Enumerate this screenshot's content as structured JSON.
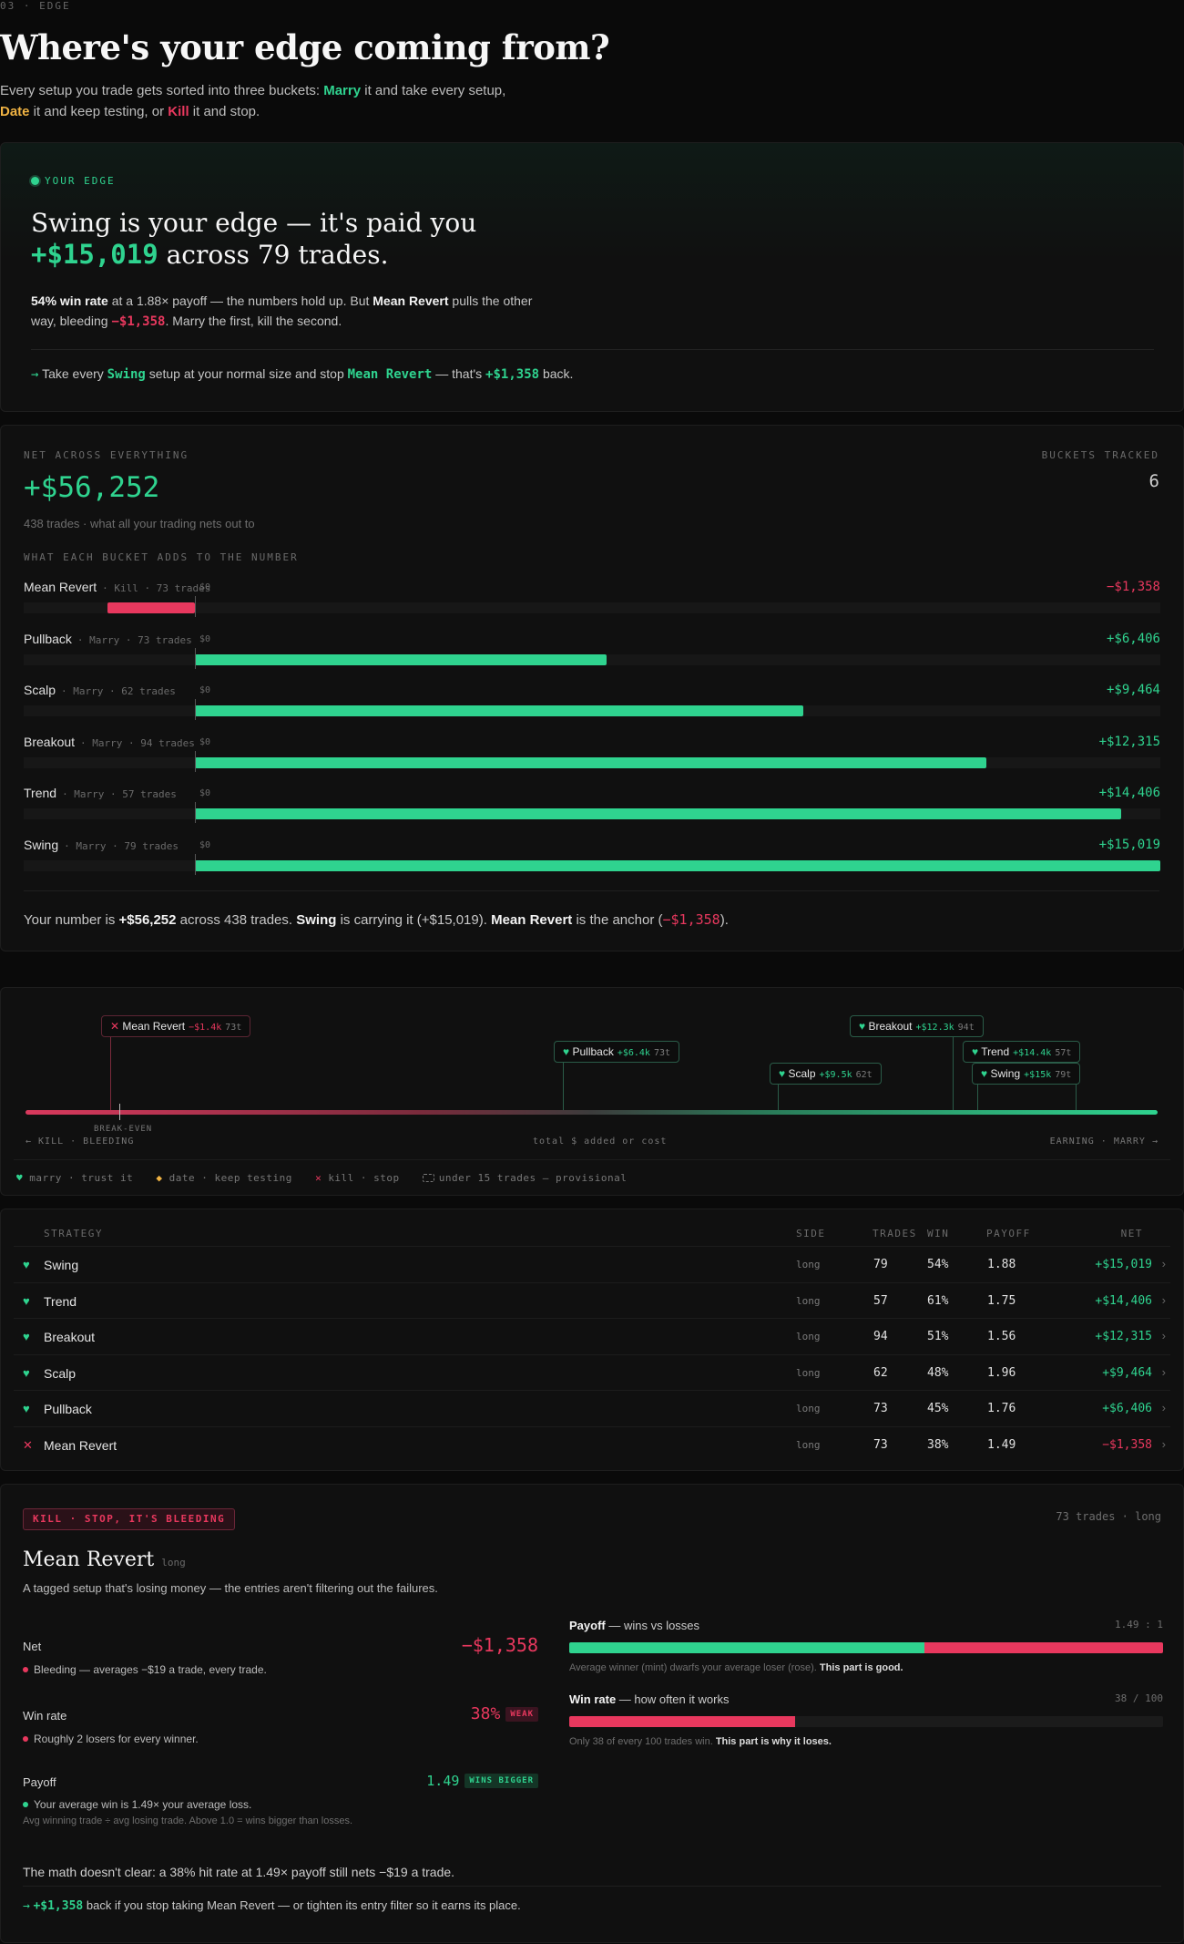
{
  "header": {
    "eyebrow": "03 · EDGE",
    "title": "Where's your edge coming from?",
    "intro_a": "Every setup you trade gets sorted into three buckets: ",
    "marry": "Marry",
    "intro_b": " it and take every setup, ",
    "date": "Date",
    "intro_c": " it and keep testing, or ",
    "kill": "Kill",
    "intro_d": " it and stop."
  },
  "edge": {
    "tag": "YOUR EDGE",
    "headline_a": "Swing is your edge — it's paid you",
    "amount": "+$15,019",
    "headline_b": " across 79 trades.",
    "p1_bold": "54% win rate",
    "p1_a": " at a 1.88× payoff — the numbers hold up. But ",
    "p1_bold2": "Mean Revert",
    "p1_b": " pulls the other way, bleeding ",
    "p1_loss": "−$1,358",
    "p1_c": ". Marry the first, kill the second.",
    "act_arrow": "→",
    "act_a": " Take every ",
    "act_swing": "Swing",
    "act_b": " setup at your normal size and stop ",
    "act_mr": "Mean Revert",
    "act_c": " — that's ",
    "act_val": "+$1,358",
    "act_d": " back."
  },
  "net": {
    "label": "NET ACROSS EVERYTHING",
    "buckets_label": "BUCKETS TRACKED",
    "total": "+$56,252",
    "buckets": "6",
    "sub": "438 trades · what all your trading nets out to",
    "adds_label": "WHAT EACH BUCKET ADDS TO THE NUMBER",
    "zero_label": "$0",
    "summary_a": "Your number is ",
    "summary_total": "+$56,252",
    "summary_b": " across 438 trades. ",
    "summary_swing": "Swing",
    "summary_c": " is carrying it (+$15,019). ",
    "summary_mr": "Mean Revert",
    "summary_d": " is the anchor (",
    "summary_loss": "−$1,358",
    "summary_e": ").",
    "rows": [
      {
        "name": "Mean Revert",
        "meta": "· Kill · 73 trades",
        "value": "−$1,358",
        "amount": -1358
      },
      {
        "name": "Pullback",
        "meta": "· Marry · 73 trades",
        "value": "+$6,406",
        "amount": 6406
      },
      {
        "name": "Scalp",
        "meta": "· Marry · 62 trades",
        "value": "+$9,464",
        "amount": 9464
      },
      {
        "name": "Breakout",
        "meta": "· Marry · 94 trades",
        "value": "+$12,315",
        "amount": 12315
      },
      {
        "name": "Trend",
        "meta": "· Marry · 57 trades",
        "value": "+$14,406",
        "amount": 14406
      },
      {
        "name": "Swing",
        "meta": "· Marry · 79 trades",
        "value": "+$15,019",
        "amount": 15019
      }
    ]
  },
  "spectrum": {
    "flags": [
      {
        "name": "Mean Revert",
        "val": "−$1.4k",
        "n": "73t",
        "kind": "kill"
      },
      {
        "name": "Pullback",
        "val": "+$6.4k",
        "n": "73t",
        "kind": "marry"
      },
      {
        "name": "Scalp",
        "val": "+$9.5k",
        "n": "62t",
        "kind": "marry"
      },
      {
        "name": "Breakout",
        "val": "+$12.3k",
        "n": "94t",
        "kind": "marry"
      },
      {
        "name": "Trend",
        "val": "+$14.4k",
        "n": "57t",
        "kind": "marry"
      },
      {
        "name": "Swing",
        "val": "+$15k",
        "n": "79t",
        "kind": "marry"
      }
    ],
    "breakeven": "BREAK-EVEN",
    "axis_left": "← KILL · BLEEDING",
    "axis_mid": "total $ added or cost",
    "axis_right": "EARNING · MARRY →",
    "legend_marry": "marry · trust it",
    "legend_date": "date · keep testing",
    "legend_kill": "kill · stop",
    "legend_prov": "under 15 trades — provisional"
  },
  "table": {
    "headers": {
      "strategy": "STRATEGY",
      "side": "SIDE",
      "trades": "TRADES",
      "win": "WIN",
      "payoff": "PAYOFF",
      "net": "NET"
    },
    "rows": [
      {
        "icon": "♥",
        "name": "Swing",
        "side": "long",
        "trades": "79",
        "win": "54%",
        "payoff": "1.88",
        "net": "+$15,019",
        "kind": "marry"
      },
      {
        "icon": "♥",
        "name": "Trend",
        "side": "long",
        "trades": "57",
        "win": "61%",
        "payoff": "1.75",
        "net": "+$14,406",
        "kind": "marry"
      },
      {
        "icon": "♥",
        "name": "Breakout",
        "side": "long",
        "trades": "94",
        "win": "51%",
        "payoff": "1.56",
        "net": "+$12,315",
        "kind": "marry"
      },
      {
        "icon": "♥",
        "name": "Scalp",
        "side": "long",
        "trades": "62",
        "win": "48%",
        "payoff": "1.96",
        "net": "+$9,464",
        "kind": "marry"
      },
      {
        "icon": "♥",
        "name": "Pullback",
        "side": "long",
        "trades": "73",
        "win": "45%",
        "payoff": "1.76",
        "net": "+$6,406",
        "kind": "marry"
      },
      {
        "icon": "✕",
        "name": "Mean Revert",
        "side": "long",
        "trades": "73",
        "win": "38%",
        "payoff": "1.49",
        "net": "−$1,358",
        "kind": "kill"
      }
    ],
    "row_more": "›"
  },
  "detail": {
    "badge": "KILL · STOP, IT'S BLEEDING",
    "top_right": "73 trades · long",
    "title": "Mean Revert",
    "side": "long",
    "desc": "A tagged setup that's losing money — the entries aren't filtering out the failures.",
    "net_k": "Net",
    "net_v": "−$1,358",
    "net_note": "Bleeding — averages −$19 a trade, every trade.",
    "win_k": "Win rate",
    "win_v": "38%",
    "win_chip": "WEAK",
    "win_note": "Roughly 2 losers for every winner.",
    "pay_k": "Payoff",
    "pay_v": "1.49",
    "pay_chip": "WINS BIGGER",
    "pay_note": "Your average win is 1.49× your average loss.",
    "pay_note2": "Avg winning trade ÷ avg losing trade. Above 1.0 = wins bigger than losses.",
    "r1_k": "Payoff",
    "r1_k2": " — wins vs losses",
    "r1_r": "1.49 : 1",
    "r1_cap": "Average winner (mint) dwarfs your average loser (rose). ",
    "r1_cap_b": "This part is good.",
    "r1_win_share": 0.598,
    "r2_k": "Win rate",
    "r2_k2": " — how often it works",
    "r2_r": "38 / 100",
    "r2_cap": "Only 38 of every 100 trades win. ",
    "r2_cap_b": "This part is why it loses.",
    "r2_pct": 38,
    "math": "The math doesn't clear: a 38% hit rate at 1.49× payoff still nets −$19 a trade.",
    "fix_arrow": "→",
    "fix_val": "+$1,358",
    "fix_text": " back if you stop taking Mean Revert — or tighten its entry filter so it earns its place."
  },
  "colors": {
    "mint": "#2fd38f",
    "rose": "#e8385e",
    "amber": "#f0b343"
  }
}
